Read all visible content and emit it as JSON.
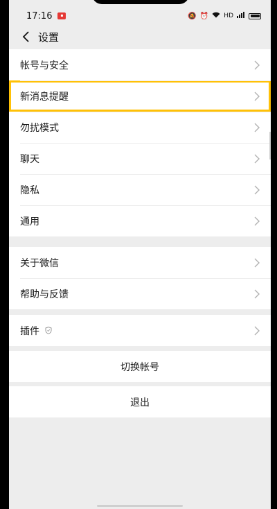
{
  "status_bar": {
    "time": "17:16",
    "network": "HD",
    "icons": [
      "mute-icon",
      "alarm-icon",
      "wifi-icon",
      "signal-icon",
      "battery-icon"
    ]
  },
  "header": {
    "title": "设置"
  },
  "groups": {
    "g1": [
      {
        "label": "帐号与安全"
      },
      {
        "label": "新消息提醒",
        "highlighted": true
      },
      {
        "label": "勿扰模式"
      },
      {
        "label": "聊天"
      },
      {
        "label": "隐私"
      },
      {
        "label": "通用"
      }
    ],
    "g2": [
      {
        "label": "关于微信"
      },
      {
        "label": "帮助与反馈"
      }
    ],
    "g3": [
      {
        "label": "插件"
      }
    ]
  },
  "actions": {
    "switch_account": "切换帐号",
    "logout": "退出"
  },
  "colors": {
    "highlight": "#ffc107",
    "background": "#ededed"
  }
}
